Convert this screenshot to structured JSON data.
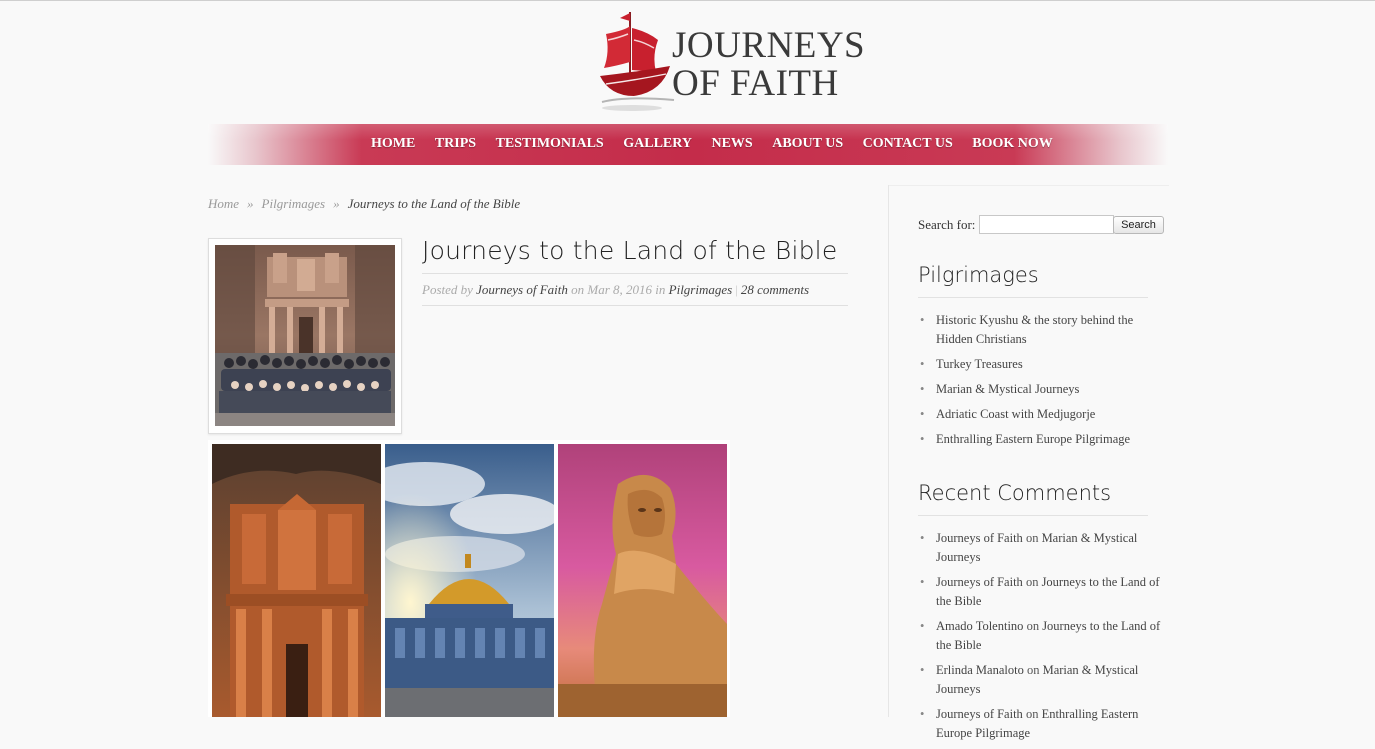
{
  "logo": {
    "line1": "JOURNEYS",
    "line2": "OF FAITH"
  },
  "nav": {
    "items": [
      "HOME",
      "TRIPS",
      "TESTIMONIALS",
      "GALLERY",
      "NEWS",
      "ABOUT US",
      "CONTACT US",
      "BOOK NOW"
    ]
  },
  "breadcrumb": {
    "home": "Home",
    "separator": "»",
    "category": "Pilgrimages",
    "current": "Journeys to the Land of the Bible"
  },
  "post": {
    "title": "Journeys to the Land of the Bible",
    "posted_by": "Posted by",
    "author": "Journeys of Faith",
    "on": "on",
    "date": "Mar 8, 2016",
    "in": "in",
    "category": "Pilgrimages",
    "comments": "28 comments"
  },
  "sidebar": {
    "search_label": "Search for:",
    "search_value": "",
    "search_button": "Search",
    "pilgrimages_heading": "Pilgrimages",
    "pilgrimages": [
      "Historic Kyushu & the story behind the Hidden Christians",
      "Turkey Treasures",
      "Marian & Mystical Journeys",
      "Adriatic Coast with Medjugorje",
      "Enthralling Eastern Europe Pilgrimage"
    ],
    "recent_heading": "Recent Comments",
    "recent": [
      {
        "author": "Journeys of Faith",
        "on": "on",
        "post": "Marian & Mystical Journeys"
      },
      {
        "author": "Journeys of Faith",
        "on": "on",
        "post": "Journeys to the Land of the Bible"
      },
      {
        "author": "Amado Tolentino",
        "on": "on",
        "post": "Journeys to the Land of the Bible"
      },
      {
        "author": "Erlinda Manaloto",
        "on": "on",
        "post": "Marian & Mystical Journeys"
      },
      {
        "author": "Journeys of Faith",
        "on": "on",
        "post": "Enthralling Eastern Europe Pilgrimage"
      }
    ]
  },
  "colors": {
    "nav_red": "#c42c4a",
    "logo_red": "#c8202e",
    "text": "#333333"
  }
}
